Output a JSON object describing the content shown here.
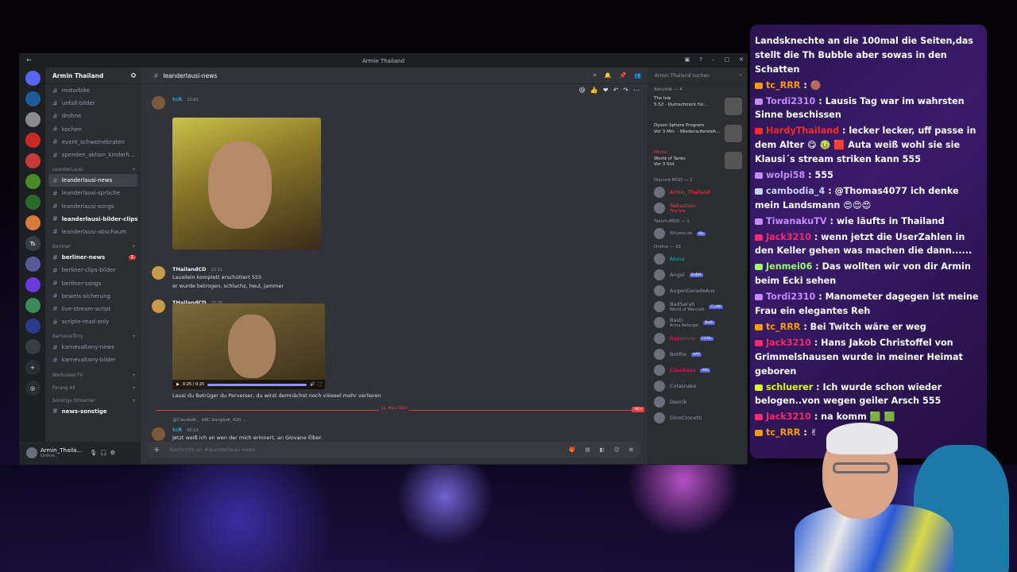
{
  "window": {
    "title": "Armin Thailand"
  },
  "server": {
    "name": "Armin Thailand"
  },
  "servers_icons": [
    "server-icon",
    "server-icon",
    "server-icon",
    "server-icon",
    "server-icon",
    "server-icon",
    "server-icon",
    "server-icon",
    "Ts",
    "server-icon",
    "twitch-icon",
    "server-icon",
    "server-icon",
    "server-icon",
    "add-server-icon",
    "explore-icon"
  ],
  "channels": [
    {
      "type": "ch",
      "label": "motorbike"
    },
    {
      "type": "ch",
      "label": "unfall-bilder"
    },
    {
      "type": "ch",
      "label": "drohne"
    },
    {
      "type": "ch",
      "label": "kochen"
    },
    {
      "type": "ch",
      "label": "event_schweinebraten"
    },
    {
      "type": "ch",
      "label": "spenden_aktion_kinderh..."
    },
    {
      "type": "cat",
      "label": "LeanderLausi"
    },
    {
      "type": "active",
      "label": "leanderlausi-news"
    },
    {
      "type": "ch",
      "label": "leanderlausi-sprüche"
    },
    {
      "type": "ch",
      "label": "leanderlausi-songs"
    },
    {
      "type": "unread",
      "label": "leanderlausi-bilder-clips"
    },
    {
      "type": "ch",
      "label": "leanderlausi-abschaum"
    },
    {
      "type": "cat",
      "label": "Berliner"
    },
    {
      "type": "unread",
      "label": "berliner-news",
      "badge": "1"
    },
    {
      "type": "ch",
      "label": "berliner-clips-bilder"
    },
    {
      "type": "ch",
      "label": "berliner-songs"
    },
    {
      "type": "ch",
      "label": "beweis-sicherung"
    },
    {
      "type": "ch",
      "label": "live-stream-script"
    },
    {
      "type": "ch",
      "label": "scripte-read-only"
    },
    {
      "type": "cat",
      "label": "KarnevalTony"
    },
    {
      "type": "ch",
      "label": "karnevaltony-news"
    },
    {
      "type": "ch",
      "label": "karnevaltony-bilder"
    },
    {
      "type": "cat",
      "label": "WeltreisenTV"
    },
    {
      "type": "cat",
      "label": "Farang Ali"
    },
    {
      "type": "cat",
      "label": "Sonstige Streamer"
    },
    {
      "type": "unread",
      "label": "news-sonstige"
    }
  ],
  "user": {
    "name": "Armin_Thaila...",
    "status": "Online"
  },
  "channel_header": {
    "name": "leanderlausi-news",
    "search_placeholder": "Armin Thailand suchen"
  },
  "messages": [
    {
      "author": "tcR",
      "time": "22:01"
    },
    {
      "author": "THailandCD",
      "time": "22:11",
      "lines": [
        "Lausilein komplett erschüttert 555",
        "er wurde betrogen, schluchz, heul, jammer"
      ]
    },
    {
      "author": "THailandCD",
      "time": "22:20",
      "video_time": "0:25 / 0:25",
      "caption": "Lausi du Betrüger du Perverser, du wirst demnächst noch viiieeel mehr verlieren"
    },
    {
      "author": "tcR",
      "time": "00:12",
      "reply": "@ClaudiaK... ARC bangkok_420 ...",
      "text": "Jetzt weiß ich an wen der mich erinnert, an Giovane Élber."
    }
  ],
  "divider": {
    "date": "11. März 2025",
    "new": "NEU"
  },
  "composer": {
    "placeholder": "Nachricht an #leanderlausi-news"
  },
  "members": {
    "activity_header": "Aktivität — 4",
    "activities": [
      {
        "name": "",
        "game": "The Isle",
        "detail": "5:52 · Dumschneck für..."
      },
      {
        "name": "",
        "game": "Dyson Sphere Program",
        "detail": "Vor 3 Min. · Wiederaufersteh..."
      },
      {
        "name": "Micha",
        "game": "World of Tanks",
        "detail": "Vor 3 Std."
      }
    ],
    "mod_header": "Discord-MOD — 2",
    "mods": [
      {
        "name": "Armin_Thailand"
      },
      {
        "name": "Sebastian",
        "sub": "The Isle"
      }
    ],
    "twitch_mod_header": "Twitch-MOD — 1",
    "twitch_mods": [
      {
        "name": "",
        "tag": "ISL",
        "sub": "Whyeou.de"
      }
    ],
    "online_header": "Online — 33",
    "online": [
      {
        "name": "Aluna",
        "color": "cyan"
      },
      {
        "name": "Angel",
        "tag": "SUBM"
      },
      {
        "name": "AugenGeradeAus"
      },
      {
        "name": "BadSarah",
        "tag": "CLAW",
        "sub": "World of Warcraft"
      },
      {
        "name": "Basti",
        "tag": "BoBi",
        "sub": "Arma Reforger"
      },
      {
        "name": "Baysonne",
        "tag": "COOL",
        "color": "pink"
      },
      {
        "name": "BotRix",
        "tag": "APP"
      },
      {
        "name": "Claudiaaa",
        "tag": "ARC",
        "color": "pink"
      },
      {
        "name": "Colasnake"
      },
      {
        "name": "Deorik"
      },
      {
        "name": "DinoCrocetti"
      }
    ]
  },
  "chat": [
    {
      "user": "",
      "text": "Landsknechte an die 100mal die Seiten,das stellt die Th Bubble aber sowas in den Schatten",
      "ucolor": "#ffffff"
    },
    {
      "user": "tc_RRR",
      "text": " : 🟤",
      "ucolor": "#ff9a00"
    },
    {
      "user": "Tordi2310",
      "text": " : Lausis Tag war im wahrsten Sinne beschissen",
      "ucolor": "#c28bff"
    },
    {
      "user": "HardyThailand",
      "text": " : lecker lecker, uff passe in dem Alter 😋 🤢 🟥 Auta weiß wohl sie sie Klausi´s stream striken kann 555",
      "ucolor": "#ff2a2a"
    },
    {
      "user": "wolpi58",
      "text": " : 555",
      "ucolor": "#c28bff"
    },
    {
      "user": "cambodia_4",
      "text": " : @Thomas4077 ich denke mein Landsmann 😍😍😍",
      "ucolor": "#c2d6ff",
      "mention": true
    },
    {
      "user": "TiwanakuTV",
      "text": " : wie läufts in Thailand",
      "ucolor": "#c28bff"
    },
    {
      "user": "Jack3210",
      "text": " : wenn jetzt die UserZahlen in den Keller gehen was machen die dann......",
      "ucolor": "#ff2a6a"
    },
    {
      "user": "Jenmei06",
      "text": " : Das wollten wir von dir Armin beim Ecki sehen",
      "ucolor": "#9aff6a"
    },
    {
      "user": "Tordi2310",
      "text": " : Manometer dagegen ist meine Frau ein elegantes Reh",
      "ucolor": "#c28bff"
    },
    {
      "user": "tc_RRR",
      "text": " : Bei Twitch wäre er weg",
      "ucolor": "#ff9a00"
    },
    {
      "user": "Jack3210",
      "text": " : Hans Jakob Christoffel von Grimmelshausen wurde in meiner Heimat geboren",
      "ucolor": "#ff2a6a"
    },
    {
      "user": "schluerer",
      "text": " : Ich wurde schon wieder belogen..von wegen geiler Arsch 555",
      "ucolor": "#d8ff2a"
    },
    {
      "user": "Jack3210",
      "text": " : na komm 🟩 🟩",
      "ucolor": "#ff2a6a"
    },
    {
      "user": "tc_RRR",
      "text": " : ✌",
      "ucolor": "#ff9a00"
    }
  ]
}
